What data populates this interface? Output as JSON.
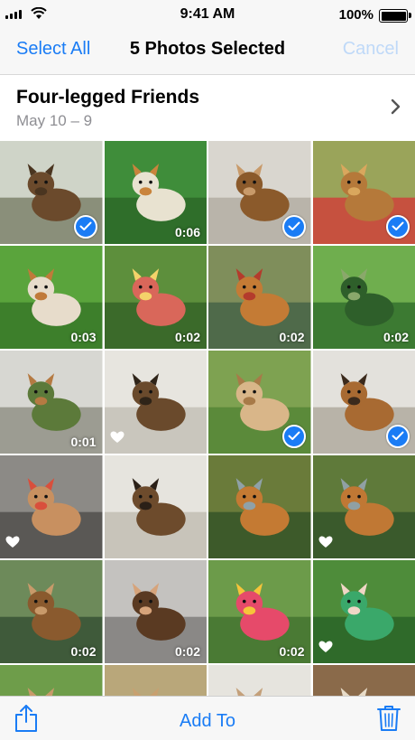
{
  "status_bar": {
    "time": "9:41 AM",
    "battery_percent": "100%",
    "battery_level": 1.0
  },
  "nav": {
    "select_all_label": "Select All",
    "title": "5 Photos Selected",
    "cancel_label": "Cancel"
  },
  "album": {
    "title": "Four-legged Friends",
    "date": "May 10 – 9",
    "chevron_icon": "chevron-right-icon"
  },
  "grid": {
    "photos": [
      {
        "subject": "dog-in-hat",
        "selected": true,
        "favorite": false,
        "duration": ""
      },
      {
        "subject": "dog-running-grass",
        "selected": false,
        "favorite": false,
        "duration": "0:06"
      },
      {
        "subject": "puppy-under-blanket",
        "selected": true,
        "favorite": false,
        "duration": ""
      },
      {
        "subject": "dog-lying-deck",
        "selected": true,
        "favorite": false,
        "duration": ""
      },
      {
        "subject": "dog-running-lawn",
        "selected": false,
        "favorite": false,
        "duration": "0:03"
      },
      {
        "subject": "girls-with-dog",
        "selected": false,
        "favorite": false,
        "duration": "0:02"
      },
      {
        "subject": "dog-in-water",
        "selected": false,
        "favorite": false,
        "duration": "0:02"
      },
      {
        "subject": "lawn-trees",
        "selected": false,
        "favorite": false,
        "duration": "0:02"
      },
      {
        "subject": "dog-by-fence",
        "selected": false,
        "favorite": false,
        "duration": "0:01"
      },
      {
        "subject": "dog-white-blanket",
        "selected": false,
        "favorite": true,
        "duration": ""
      },
      {
        "subject": "dog-sitting-grass",
        "selected": true,
        "favorite": false,
        "duration": ""
      },
      {
        "subject": "dog-in-car-seat",
        "selected": true,
        "favorite": false,
        "duration": ""
      },
      {
        "subject": "dog-party-hat",
        "selected": false,
        "favorite": true,
        "duration": ""
      },
      {
        "subject": "dog-under-sheet",
        "selected": false,
        "favorite": false,
        "duration": ""
      },
      {
        "subject": "dog-in-stream",
        "selected": false,
        "favorite": false,
        "duration": ""
      },
      {
        "subject": "dog-in-stream-2",
        "selected": false,
        "favorite": true,
        "duration": ""
      },
      {
        "subject": "dog-in-car",
        "selected": false,
        "favorite": false,
        "duration": "0:02"
      },
      {
        "subject": "dog-with-toy",
        "selected": false,
        "favorite": false,
        "duration": "0:02"
      },
      {
        "subject": "dog-hammock-rainbow",
        "selected": false,
        "favorite": false,
        "duration": "0:02"
      },
      {
        "subject": "girl-dog-hammock",
        "selected": false,
        "favorite": true,
        "duration": ""
      },
      {
        "subject": "dog-partial-1",
        "selected": false,
        "favorite": false,
        "duration": ""
      },
      {
        "subject": "dog-partial-2",
        "selected": false,
        "favorite": false,
        "duration": ""
      },
      {
        "subject": "dog-partial-3",
        "selected": false,
        "favorite": false,
        "duration": ""
      },
      {
        "subject": "dog-partial-4",
        "selected": false,
        "favorite": false,
        "duration": ""
      }
    ]
  },
  "toolbar": {
    "add_to_label": "Add To",
    "share_icon": "share-icon",
    "trash_icon": "trash-icon"
  },
  "colors": {
    "accent": "#1a7cf5",
    "disabled": "#bfd9f8",
    "secondary_text": "#8e8e93"
  }
}
